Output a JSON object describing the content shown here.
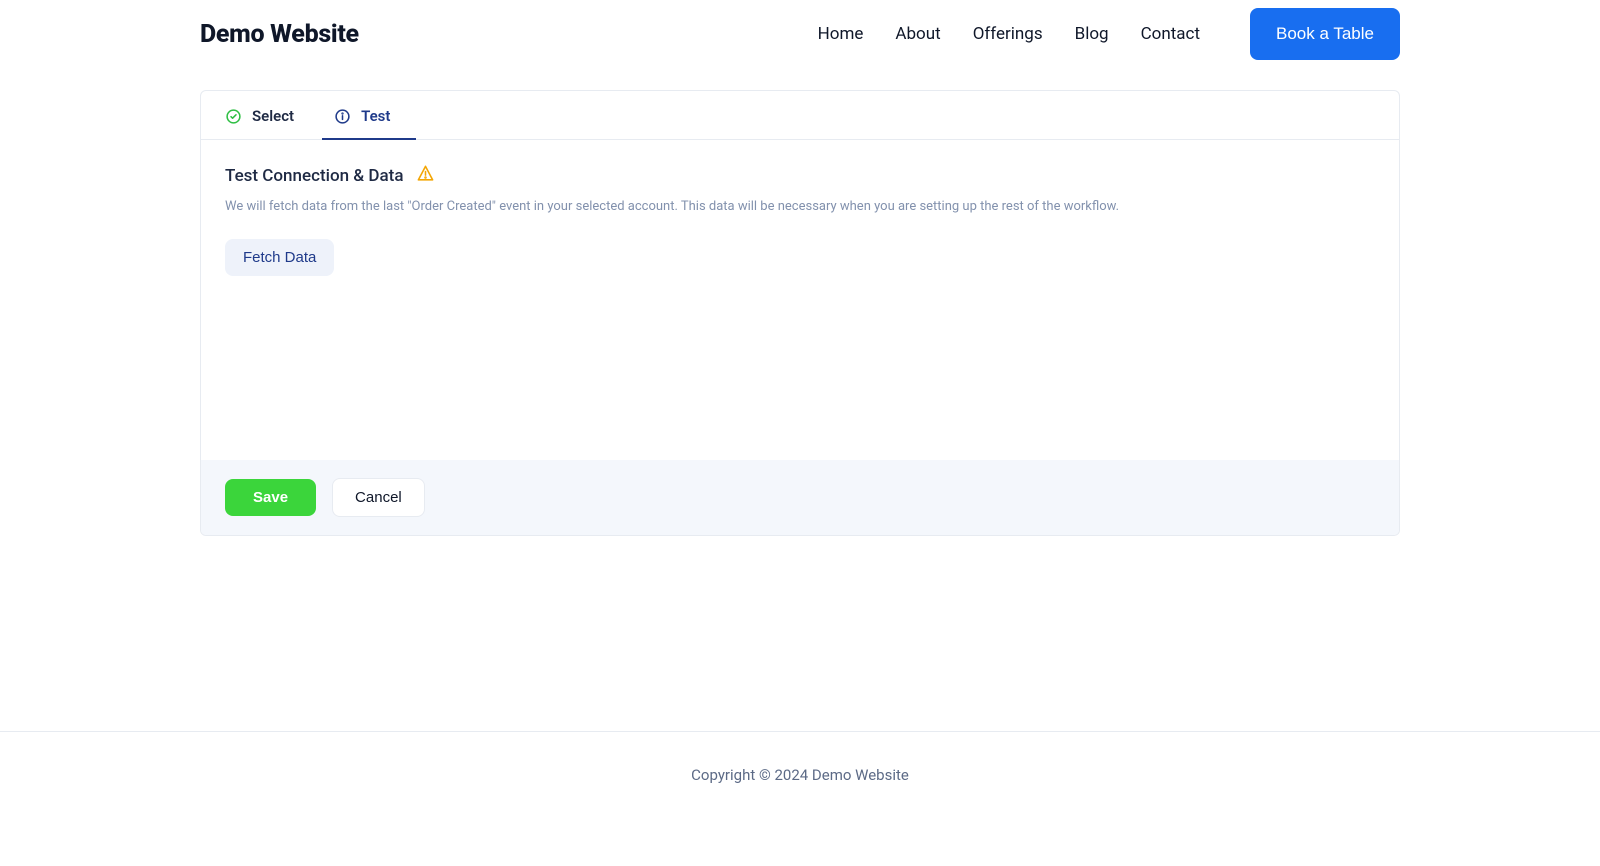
{
  "header": {
    "logo": "Demo Website",
    "nav": [
      {
        "label": "Home"
      },
      {
        "label": "About"
      },
      {
        "label": "Offerings"
      },
      {
        "label": "Blog"
      },
      {
        "label": "Contact"
      }
    ],
    "cta_label": "Book a Table"
  },
  "tabs": {
    "select": {
      "label": "Select"
    },
    "test": {
      "label": "Test"
    }
  },
  "section": {
    "title": "Test Connection & Data",
    "description": "We will fetch data from the last \"Order Created\" event in your selected account. This data will be necessary when you are setting up the rest of the workflow.",
    "fetch_label": "Fetch Data"
  },
  "actions": {
    "save_label": "Save",
    "cancel_label": "Cancel"
  },
  "footer": {
    "text": "Copyright © 2024 Demo Website"
  }
}
